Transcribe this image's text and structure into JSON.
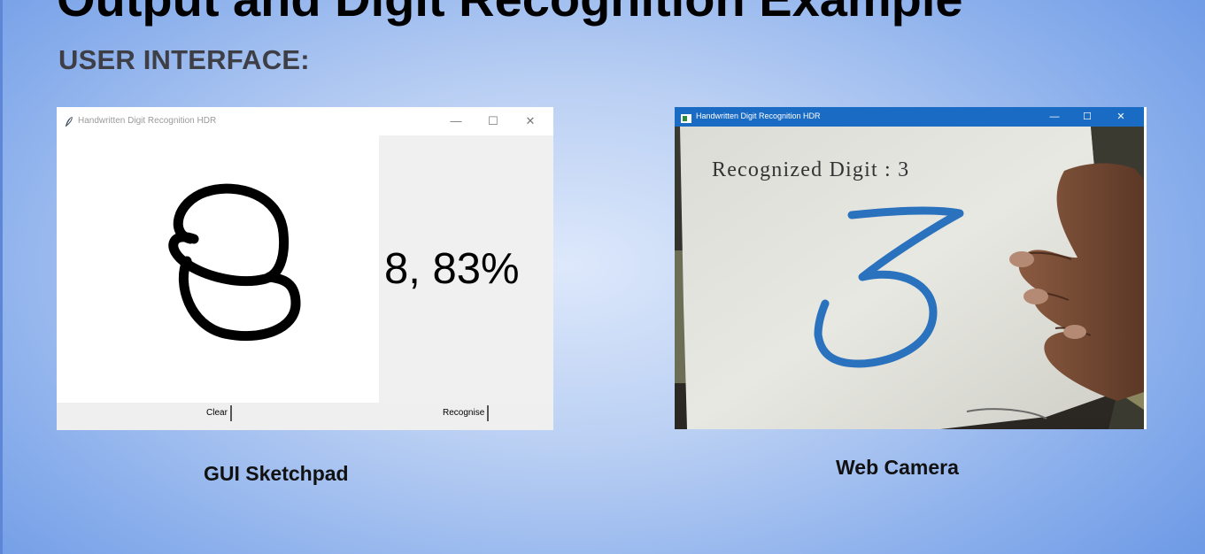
{
  "slide": {
    "top_title": "Output and Digit Recognition Example",
    "section_heading": "USER INTERFACE:"
  },
  "gui_window": {
    "title": "Handwritten Digit Recognition HDR",
    "controls": [
      "—",
      "☐",
      "✕"
    ],
    "result_text": "8, 83%",
    "clear_label": "Clear",
    "recognise_label": "Recognise",
    "caption": "GUI Sketchpad"
  },
  "camera_window": {
    "title": "Handwritten Digit Recognition HDR",
    "controls": [
      "—",
      "☐",
      "✕"
    ],
    "overlay_text": "Recognized Digit : 3",
    "caption": "Web Camera"
  },
  "icons": {
    "gui_app_icon": "feather-icon",
    "camera_app_icon": "window-app-icon"
  },
  "colors": {
    "camera_titlebar": "#1a6bc4",
    "digit_ink": "#2a72bd",
    "sketch_ink": "#000000"
  }
}
